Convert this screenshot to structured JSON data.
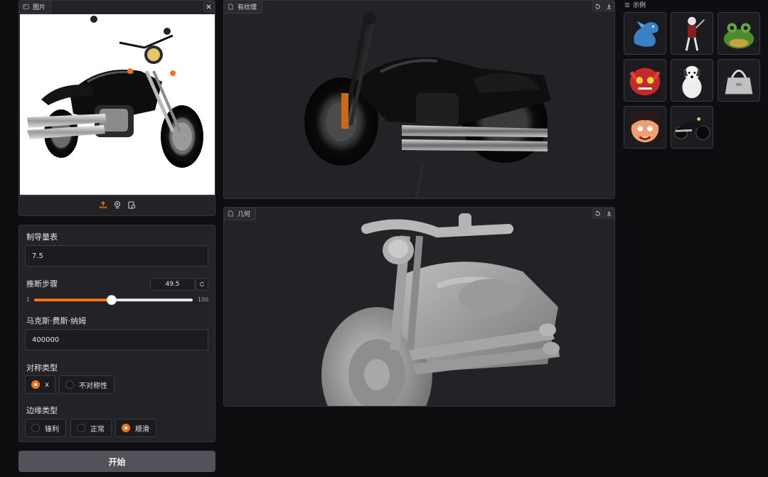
{
  "image_panel": {
    "tag": "图片",
    "upload_icon": "upload-icon",
    "webcam_icon": "webcam-icon",
    "clipboard_icon": "clipboard-icon"
  },
  "textured_panel": {
    "tag": "有纹理"
  },
  "geometry_panel": {
    "tag": "几何"
  },
  "examples": {
    "tag": "示例",
    "items": [
      "dragon",
      "skeleton-warrior",
      "frog",
      "red-monster",
      "dog",
      "handbag",
      "cartoon-girl",
      "motorcycle"
    ]
  },
  "settings": {
    "guidance_label": "制导量表",
    "guidance_value": "7.5",
    "steps_label": "推断步骤",
    "steps_value": "49.5",
    "steps_min": "1",
    "steps_max": "100",
    "steps_fraction": 0.49,
    "max_faces_label": "马克斯·费斯·纳姆",
    "max_faces_value": "400000",
    "symmetry_label": "对称类型",
    "symmetry_options": [
      "x",
      "不对称性"
    ],
    "symmetry_selected": "x",
    "edge_label": "边缘类型",
    "edge_options": [
      "锋利",
      "正常",
      "顺滑"
    ],
    "edge_selected": "顺滑"
  },
  "start_button": "开始",
  "colors": {
    "accent": "#f97316",
    "panel": "#232327",
    "background": "#0e0e11"
  }
}
